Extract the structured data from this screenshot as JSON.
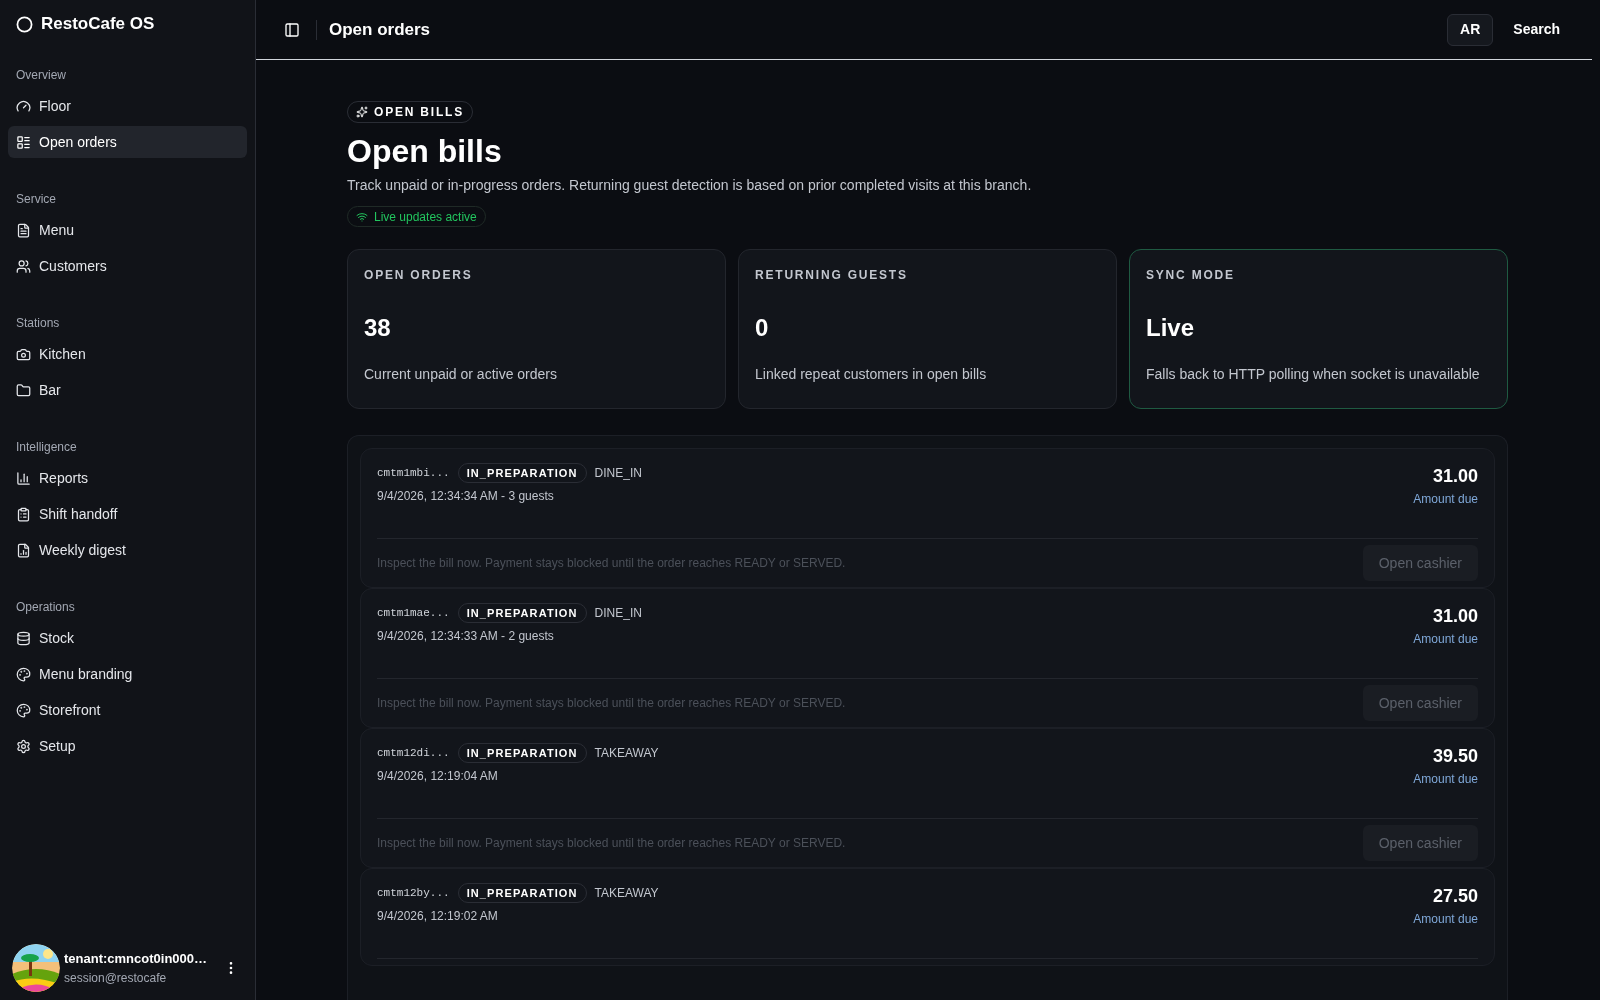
{
  "sidebar": {
    "brand": "RestoCafe OS",
    "sections": [
      {
        "title": "Overview",
        "items": [
          {
            "label": "Floor",
            "selected": false
          },
          {
            "label": "Open orders",
            "selected": true
          }
        ]
      },
      {
        "title": "Service",
        "items": [
          {
            "label": "Menu",
            "selected": false
          },
          {
            "label": "Customers",
            "selected": false
          }
        ]
      },
      {
        "title": "Stations",
        "items": [
          {
            "label": "Kitchen",
            "selected": false
          },
          {
            "label": "Bar",
            "selected": false
          }
        ]
      },
      {
        "title": "Intelligence",
        "items": [
          {
            "label": "Reports",
            "selected": false
          },
          {
            "label": "Shift handoff",
            "selected": false
          },
          {
            "label": "Weekly digest",
            "selected": false
          }
        ]
      },
      {
        "title": "Operations",
        "items": [
          {
            "label": "Stock",
            "selected": false
          },
          {
            "label": "Menu branding",
            "selected": false
          },
          {
            "label": "Storefront",
            "selected": false
          },
          {
            "label": "Setup",
            "selected": false
          }
        ]
      }
    ],
    "user": {
      "name": "tenant:cmncot0in000…",
      "email": "session@restocafe"
    }
  },
  "header": {
    "title": "Open orders",
    "language": "AR",
    "search": "Search"
  },
  "page": {
    "eyebrow": "OPEN BILLS",
    "title": "Open bills",
    "description": "Track unpaid or in-progress orders. Returning guest detection is based on prior completed visits at this branch.",
    "live_status": "Live updates active"
  },
  "stats": [
    {
      "label": "OPEN ORDERS",
      "value": "38",
      "caption": "Current unpaid or active orders",
      "highlighted": false
    },
    {
      "label": "RETURNING GUESTS",
      "value": "0",
      "caption": "Linked repeat customers in open bills",
      "highlighted": false
    },
    {
      "label": "SYNC MODE",
      "value": "Live",
      "caption": "Falls back to HTTP polling when socket is unavailable",
      "highlighted": true
    }
  ],
  "orders": [
    {
      "id": "cmtm1mbi...",
      "status": "IN_PREPARATION",
      "type": "DINE_IN",
      "meta": "9/4/2026, 12:34:34 AM - 3 guests",
      "amount": "31.00",
      "amount_label": "Amount due",
      "note": "Inspect the bill now. Payment stays blocked until the order reaches READY or SERVED.",
      "action": "Open cashier"
    },
    {
      "id": "cmtm1mae...",
      "status": "IN_PREPARATION",
      "type": "DINE_IN",
      "meta": "9/4/2026, 12:34:33 AM - 2 guests",
      "amount": "31.00",
      "amount_label": "Amount due",
      "note": "Inspect the bill now. Payment stays blocked until the order reaches READY or SERVED.",
      "action": "Open cashier"
    },
    {
      "id": "cmtm12di...",
      "status": "IN_PREPARATION",
      "type": "TAKEAWAY",
      "meta": "9/4/2026, 12:19:04 AM",
      "amount": "39.50",
      "amount_label": "Amount due",
      "note": "Inspect the bill now. Payment stays blocked until the order reaches READY or SERVED.",
      "action": "Open cashier"
    },
    {
      "id": "cmtm12by...",
      "status": "IN_PREPARATION",
      "type": "TAKEAWAY",
      "meta": "9/4/2026, 12:19:02 AM",
      "amount": "27.50",
      "amount_label": "Amount due"
    }
  ]
}
